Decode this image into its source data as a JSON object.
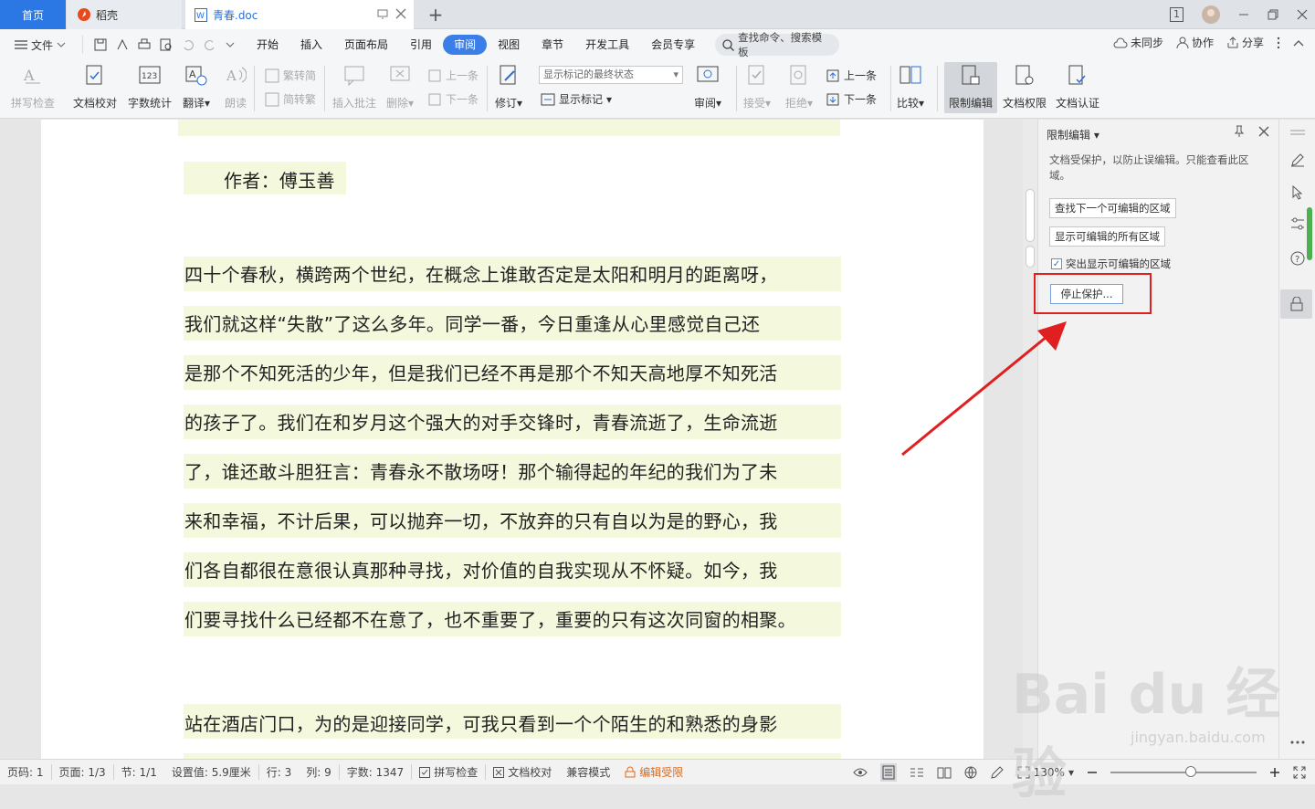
{
  "tabs": {
    "home": "首页",
    "daoke": "稻壳",
    "doc": "青春.doc",
    "add": "+"
  },
  "window": {
    "counter": "1"
  },
  "menu": {
    "file": "文件",
    "items": [
      "开始",
      "插入",
      "页面布局",
      "引用",
      "审阅",
      "视图",
      "章节",
      "开发工具",
      "会员专享"
    ],
    "active_index": 4,
    "search": "查找命令、搜索模板",
    "sync": "未同步",
    "collab": "协作",
    "share": "分享"
  },
  "ribbon": {
    "spell": "拼写检查",
    "proof": "文档校对",
    "wordcount": "字数统计",
    "translate": "翻译",
    "read": "朗读",
    "trad": "繁转简",
    "simp": "简转繁",
    "insert_comment": "插入批注",
    "delete": "删除",
    "prev_comment": "上一条",
    "next_comment": "下一条",
    "revise": "修订",
    "markup_state": "显示标记的最终状态",
    "show_markup": "显示标记",
    "review": "审阅",
    "accept": "接受",
    "reject": "拒绝",
    "prev_change": "上一条",
    "next_change": "下一条",
    "compare": "比较",
    "restrict": "限制编辑",
    "doc_rights": "文档权限",
    "doc_cert": "文档认证"
  },
  "doc": {
    "author": "作者：傅玉善",
    "lines": [
      "四十个春秋，横跨两个世纪，在概念上谁敢否定是太阳和明月的距离呀，",
      "我们就这样“失散”了这么多年。同学一番，今日重逢从心里感觉自己还",
      "是那个不知死活的少年，但是我们已经不再是那个不知天高地厚不知死活",
      "的孩子了。我们在和岁月这个强大的对手交锋时，青春流逝了，生命流逝",
      "了，谁还敢斗胆狂言：青春永不散场呀！那个输得起的年纪的我们为了未",
      "来和幸福，不计后果，可以抛弃一切，不放弃的只有自以为是的野心，我",
      "们各自都很在意很认真那种寻找，对价值的自我实现从不怀疑。如今，我",
      "们要寻找什么已经都不在意了，也不重要了，重要的只有这次同窗的相聚。"
    ],
    "line2": "站在酒店门口，为的是迎接同学，可我只看到一个个陌生的和熟悉的身影"
  },
  "panel": {
    "title": "限制编辑",
    "desc": "文档受保护，以防止误编辑。只能查看此区域。",
    "find_next": "查找下一个可编辑的区域",
    "show_all": "显示可编辑的所有区域",
    "highlight": "突出显示可编辑的区域",
    "stop": "停止保护..."
  },
  "status": {
    "page": "页码: 1",
    "pages": "页面: 1/3",
    "section": "节: 1/1",
    "setting": "设置值: 5.9厘米",
    "row": "行: 3",
    "col": "列: 9",
    "words": "字数: 1347",
    "spell": "拼写检查",
    "proof": "文档校对",
    "compat": "兼容模式",
    "restricted": "编辑受限",
    "zoom": "130%"
  },
  "watermark": {
    "logo": "Bai du 经验",
    "url": "jingyan.baidu.com"
  },
  "colors": {
    "accent": "#3c7ee8",
    "highlight": "#f4f8dd",
    "annotation": "#e02020",
    "warning": "#e06a1a"
  }
}
